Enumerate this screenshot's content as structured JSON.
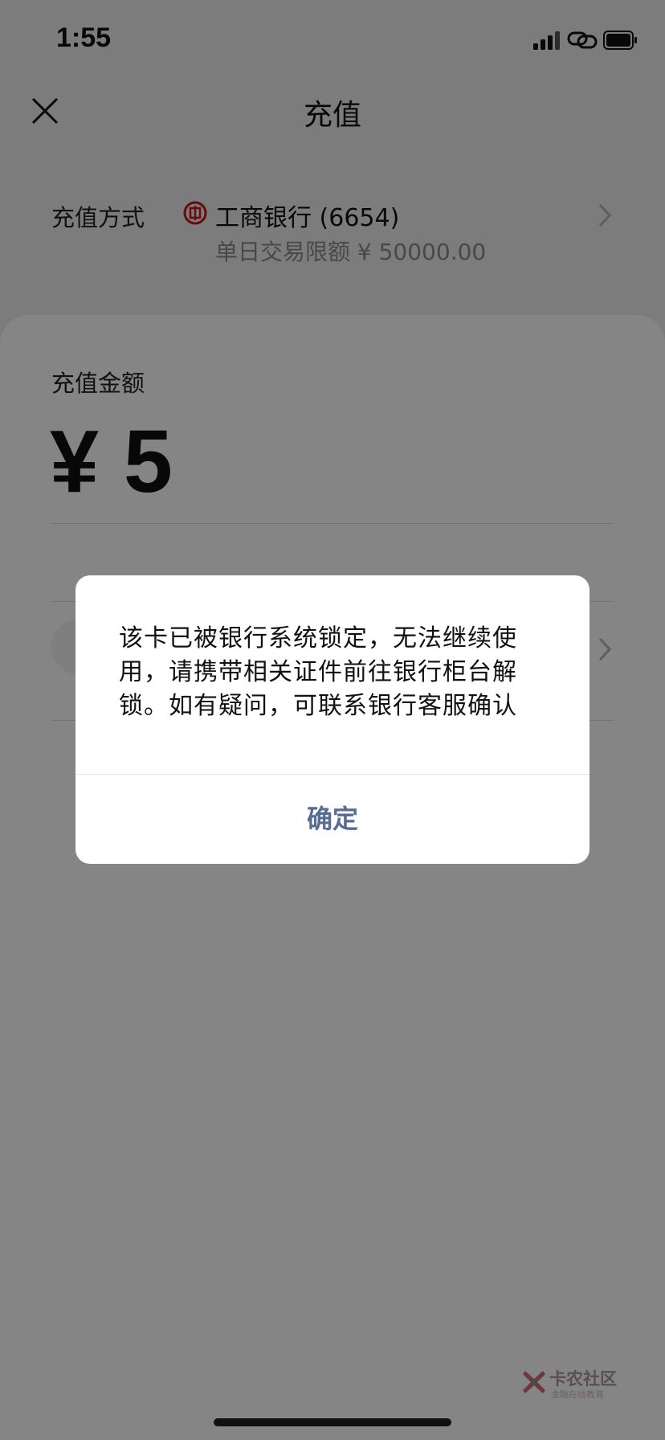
{
  "status_bar": {
    "time": "1:55"
  },
  "nav": {
    "title": "充值"
  },
  "payment_method": {
    "label": "充值方式",
    "bank_name": "工商银行 (6654)",
    "daily_limit": "单日交易限额 ¥ 50000.00"
  },
  "amount": {
    "label": "充值金额",
    "value": "¥ 5"
  },
  "dialog": {
    "message": "该卡已被银行系统锁定，无法继续使用，请携带相关证件前往银行柜台解锁。如有疑问，可联系银行客服确认",
    "confirm_label": "确定"
  },
  "watermark": {
    "title": "卡农社区",
    "subtitle": "金融在线教育"
  },
  "colors": {
    "confirm_text": "#576b95",
    "overlay": "rgba(0,0,0,0.48)",
    "bank_logo": "#c8161d"
  }
}
